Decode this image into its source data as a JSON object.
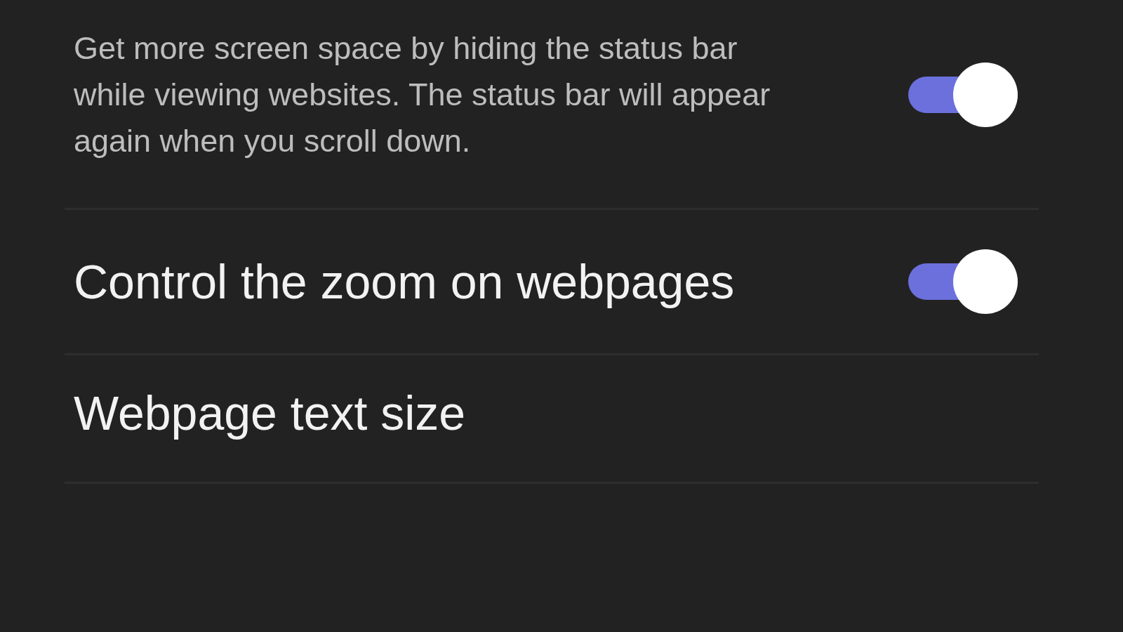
{
  "settings": [
    {
      "kind": "switch",
      "description": "Get more screen space by hiding the status bar while viewing websites. The status bar will appear again when you scroll down.",
      "on": true
    },
    {
      "kind": "switch",
      "title": "Control the zoom on webpages",
      "on": true
    },
    {
      "kind": "link",
      "title": "Webpage text size"
    }
  ]
}
